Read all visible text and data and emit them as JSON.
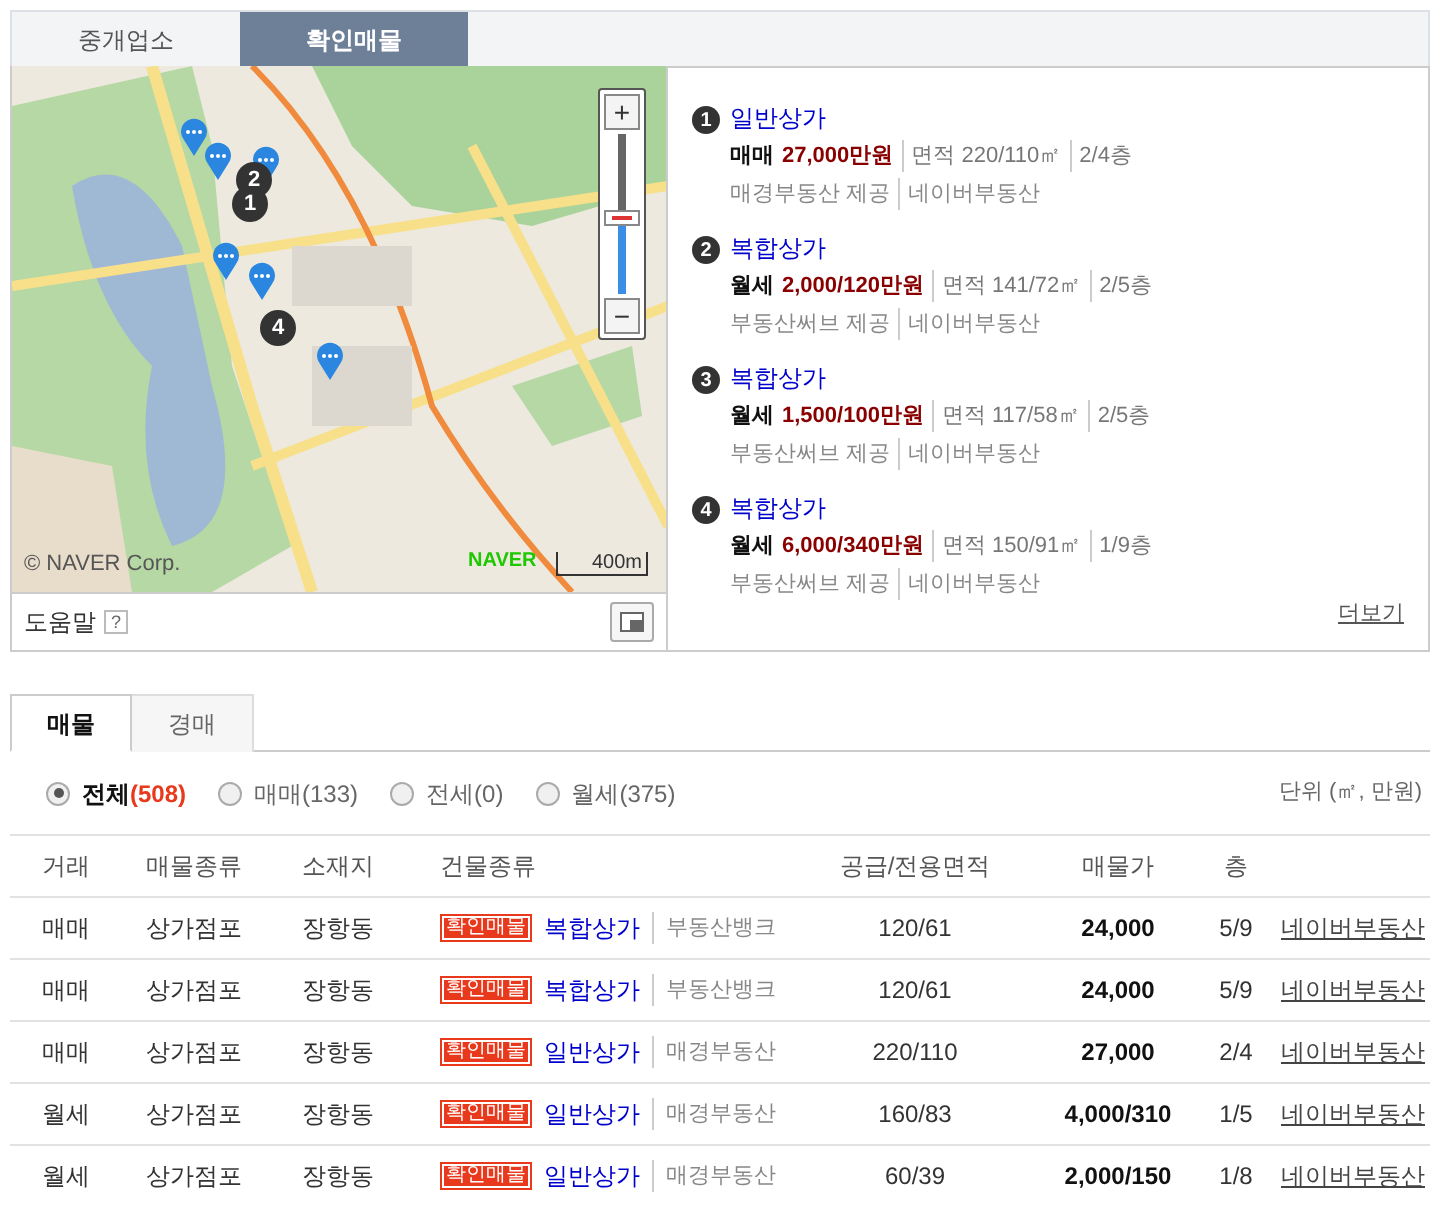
{
  "top_tabs": [
    {
      "label": "중개업소",
      "selected": false
    },
    {
      "label": "확인매물",
      "selected": true
    }
  ],
  "map": {
    "markers": [
      {
        "kind": "pin"
      },
      {
        "kind": "pin"
      },
      {
        "kind": "pin"
      },
      {
        "kind": "pin"
      },
      {
        "kind": "pin"
      },
      {
        "kind": "pin"
      },
      {
        "kind": "numbered",
        "label": "2"
      },
      {
        "kind": "numbered",
        "label": "1"
      },
      {
        "kind": "numbered",
        "label": "4"
      }
    ],
    "zoom": {
      "plus": "+",
      "minus": "−",
      "level": 0.47
    },
    "copyright": "© NAVER Corp.",
    "logo": "NAVER",
    "scale": "400m"
  },
  "help": {
    "label": "도움말",
    "mark": "?"
  },
  "listings": [
    {
      "number": "1",
      "title": "일반상가",
      "trade": "매매",
      "price": "27,000만원",
      "area": "면적 220/110㎡",
      "floor": "2/4층",
      "provider": "매경부동산 제공",
      "source": "네이버부동산"
    },
    {
      "number": "2",
      "title": "복합상가",
      "trade": "월세",
      "price": "2,000/120만원",
      "area": "면적 141/72㎡",
      "floor": "2/5층",
      "provider": "부동산써브 제공",
      "source": "네이버부동산"
    },
    {
      "number": "3",
      "title": "복합상가",
      "trade": "월세",
      "price": "1,500/100만원",
      "area": "면적 117/58㎡",
      "floor": "2/5층",
      "provider": "부동산써브 제공",
      "source": "네이버부동산"
    },
    {
      "number": "4",
      "title": "복합상가",
      "trade": "월세",
      "price": "6,000/340만원",
      "area": "면적 150/91㎡",
      "floor": "1/9층",
      "provider": "부동산써브 제공",
      "source": "네이버부동산"
    }
  ],
  "more": "더보기",
  "bottom_tabs": [
    {
      "label": "매물",
      "selected": true
    },
    {
      "label": "경매",
      "selected": false
    }
  ],
  "filters": [
    {
      "label": "전체",
      "count": "(508)",
      "selected": true
    },
    {
      "label": "매매",
      "count": "(133)",
      "selected": false
    },
    {
      "label": "전세",
      "count": "(0)",
      "selected": false
    },
    {
      "label": "월세",
      "count": "(375)",
      "selected": false
    }
  ],
  "unit": "단위 (㎡, 만원)",
  "table": {
    "columns": [
      "거래",
      "매물종류",
      "소재지",
      "건물종류",
      "공급/전용면적",
      "매물가",
      "층"
    ],
    "rows": [
      {
        "trade": "매매",
        "type": "상가점포",
        "location": "장항동",
        "badge": "확인매물",
        "building": "복합상가",
        "agency": "부동산뱅크",
        "area": "120/61",
        "price": "24,000",
        "floor": "5/9",
        "link": "네이버부동산"
      },
      {
        "trade": "매매",
        "type": "상가점포",
        "location": "장항동",
        "badge": "확인매물",
        "building": "복합상가",
        "agency": "부동산뱅크",
        "area": "120/61",
        "price": "24,000",
        "floor": "5/9",
        "link": "네이버부동산"
      },
      {
        "trade": "매매",
        "type": "상가점포",
        "location": "장항동",
        "badge": "확인매물",
        "building": "일반상가",
        "agency": "매경부동산",
        "area": "220/110",
        "price": "27,000",
        "floor": "2/4",
        "link": "네이버부동산"
      },
      {
        "trade": "월세",
        "type": "상가점포",
        "location": "장항동",
        "badge": "확인매물",
        "building": "일반상가",
        "agency": "매경부동산",
        "area": "160/83",
        "price": "4,000/310",
        "floor": "1/5",
        "link": "네이버부동산"
      },
      {
        "trade": "월세",
        "type": "상가점포",
        "location": "장항동",
        "badge": "확인매물",
        "building": "일반상가",
        "agency": "매경부동산",
        "area": "60/39",
        "price": "2,000/150",
        "floor": "1/8",
        "link": "네이버부동산"
      }
    ]
  }
}
